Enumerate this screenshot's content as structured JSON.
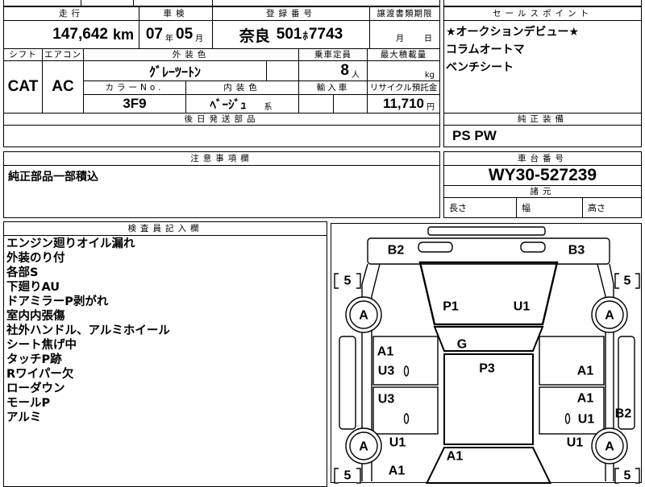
{
  "mileage": {
    "label": "走行",
    "value": "147,642",
    "unit": "km"
  },
  "inspection": {
    "label": "車検",
    "year": "07",
    "year_unit": "年",
    "month": "05",
    "month_unit": "月"
  },
  "registration": {
    "label": "登録番号",
    "region": "奈良",
    "class_no": "501",
    "kana": "ﾎ",
    "number": "7743"
  },
  "transfer_deadline": {
    "label": "譲渡書類期限",
    "month_unit": "月",
    "day_unit": "日"
  },
  "shift": {
    "label": "シフト",
    "value": "CAT"
  },
  "aircon": {
    "label": "エアコン",
    "value": "AC"
  },
  "exterior_color": {
    "label": "外装色",
    "value": "ｸﾞﾚｰﾂｰﾄﾝ"
  },
  "capacity": {
    "label": "乗車定員",
    "value": "8",
    "unit": "人"
  },
  "max_load": {
    "label": "最大積載量",
    "unit": "kg"
  },
  "color_no": {
    "label": "カラーNo.",
    "value": "3F9"
  },
  "interior_color": {
    "label": "内装色",
    "value": "ﾍﾞｰｼﾞｭ",
    "suffix": "系"
  },
  "import_car": {
    "label": "輸入車"
  },
  "recycle_deposit": {
    "label": "リサイクル預託金",
    "value": "11,710",
    "unit": "円"
  },
  "later_parts": {
    "label": "後日発送部品"
  },
  "sales_points": {
    "label": "セールスポイント",
    "items": [
      "★オークションデビュー★",
      "コラムオートマ",
      "ベンチシート"
    ]
  },
  "genuine_equipment": {
    "label": "純正装備",
    "value": "PS PW"
  },
  "notes": {
    "label": "注意事項欄",
    "value": "純正部品一部積込"
  },
  "chassis": {
    "label": "車台番号",
    "value": "WY30-527239"
  },
  "specs": {
    "label": "諸元",
    "length_label": "長さ",
    "width_label": "幅",
    "height_label": "高さ"
  },
  "inspector": {
    "label": "検査員記入欄",
    "lines": [
      "エンジン廻りオイル漏れ",
      "外装のり付",
      "各部S",
      "下廻りAU",
      "ドアミラーP剥がれ",
      "室内内張傷",
      "社外ハンドル、アルミホイール",
      "シート焦げ中",
      "タッチP跡",
      "Rワイパー欠",
      "ローダウン",
      "モールP",
      "アルミ"
    ]
  },
  "diagram": {
    "front_bumper_left": "B2",
    "front_bumper_right": "B3",
    "tread_front_left": "5",
    "tread_front_right": "5",
    "wheel_front_left": "A",
    "wheel_front_right": "A",
    "hood_left": "P1",
    "hood_right": "U1",
    "windshield": "G",
    "front_door_left_a": "A1",
    "front_door_left_b": "U3",
    "roof": "P3",
    "front_door_right": "A1",
    "rear_door_left": "U3",
    "rear_door_right_a": "A1",
    "rear_door_right_b": "U1",
    "right_side_rear": "B2",
    "wheel_rear_left": "A",
    "rear_fender_left": "U1",
    "rear_fender_right": "U1",
    "wheel_rear_right": "A",
    "rear_center": "A1",
    "rear_left": "A1",
    "tread_rear_left": "5",
    "tread_rear_right": "5"
  }
}
